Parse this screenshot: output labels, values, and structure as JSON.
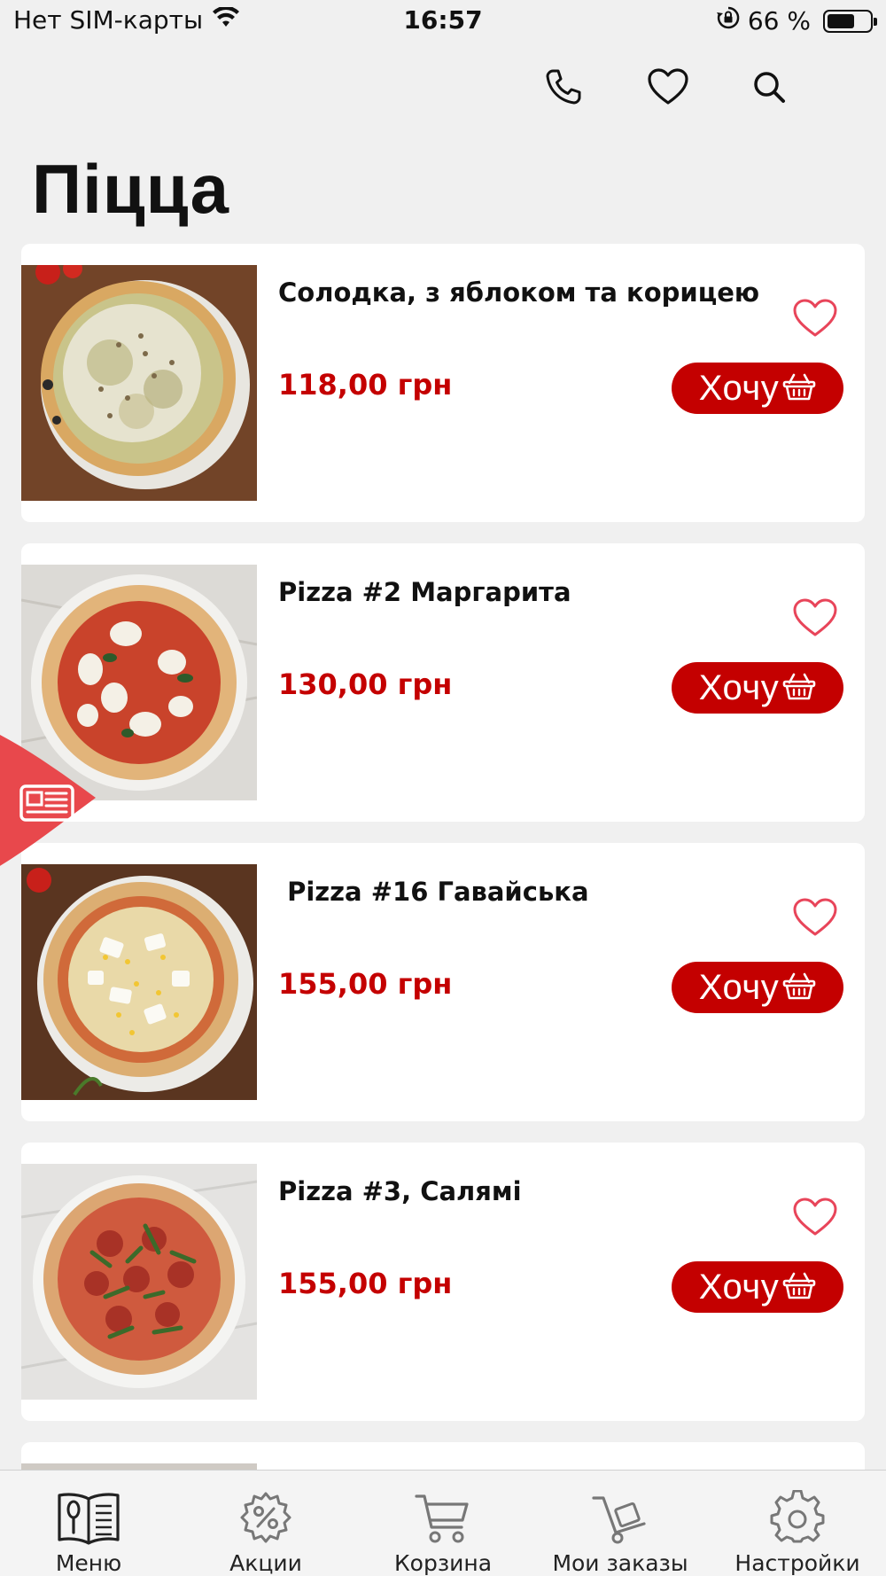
{
  "status_bar": {
    "carrier": "Нет SIM-карты",
    "time": "16:57",
    "battery": "66 %",
    "battery_level": 0.66
  },
  "header": {
    "icons": [
      "phone-icon",
      "heart-icon",
      "search-icon"
    ]
  },
  "page": {
    "title": "Піцца"
  },
  "colors": {
    "accent": "#c40000",
    "heart": "#e8455a",
    "background": "#f0f0f0",
    "card": "#ffffff"
  },
  "products": [
    {
      "name": "Солодка, з яблоком та корицею",
      "price": "118,00 грн",
      "button": "Хочу"
    },
    {
      "name": "Pizza #2 Маргарита",
      "price": "130,00 грн",
      "button": "Хочу"
    },
    {
      "name": " Pizza #16 Гавайська",
      "price": "155,00 грн",
      "button": "Хочу"
    },
    {
      "name": "Pizza #3, Салямі",
      "price": "155,00 грн",
      "button": "Хочу"
    }
  ],
  "tabbar": {
    "items": [
      {
        "label": "Меню",
        "icon": "menu-book-icon",
        "active": true
      },
      {
        "label": "Акции",
        "icon": "discount-gear-icon"
      },
      {
        "label": "Корзина",
        "icon": "cart-icon"
      },
      {
        "label": "Мои заказы",
        "icon": "hand-truck-icon"
      },
      {
        "label": "Настройки",
        "icon": "settings-gear-icon"
      }
    ]
  }
}
